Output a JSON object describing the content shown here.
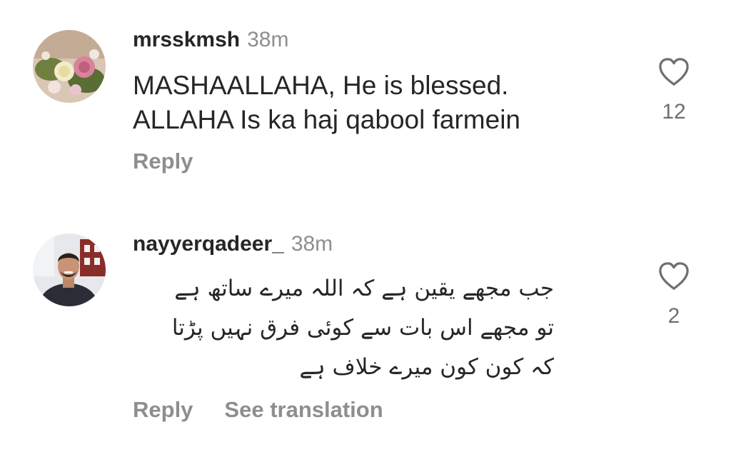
{
  "comments": [
    {
      "username": "mrsskmsh",
      "time": "38m",
      "lines": [
        "MASHAALLAHA, He is blessed.",
        "ALLAHA Is ka haj qabool farmein"
      ],
      "like_count": "12",
      "reply_label": "Reply",
      "avatar_icon": "flower-bouquet-avatar"
    },
    {
      "username": "nayyerqadeer_",
      "time": "38m",
      "lines": [
        "جب مجھے یقین ہے کہ اللہ میرے ساتھ ہے",
        "تو مجھے اس بات سے کوئی فرق نہیں پڑتا",
        "کہ کون کون میرے خلاف ہے"
      ],
      "like_count": "2",
      "reply_label": "Reply",
      "translate_label": "See translation",
      "avatar_icon": "profile-photo-avatar"
    }
  ],
  "colors": {
    "text": "#262626",
    "secondary": "#8e8e8e"
  }
}
